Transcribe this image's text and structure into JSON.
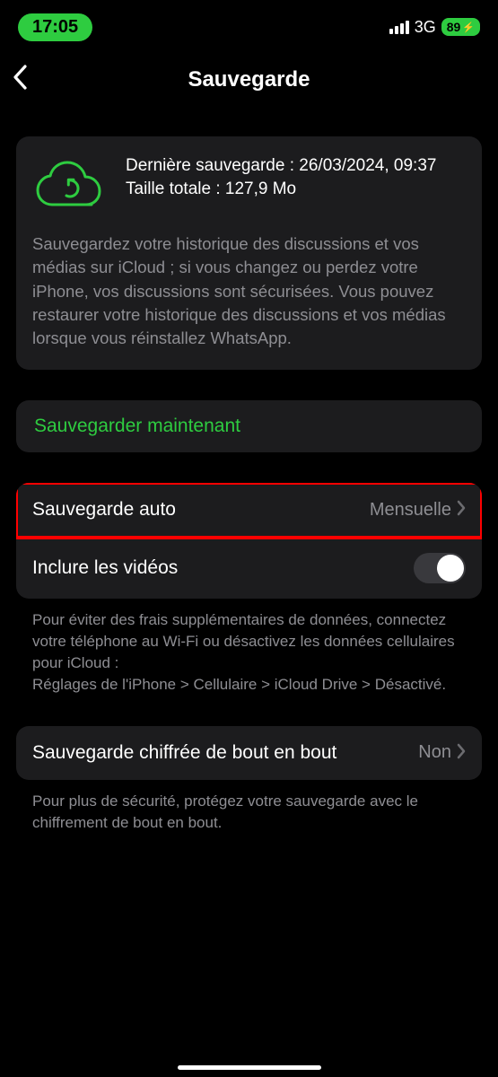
{
  "status_bar": {
    "time": "17:05",
    "network_label": "3G",
    "battery_text": "89"
  },
  "header": {
    "title": "Sauvegarde"
  },
  "info": {
    "last_backup_line": "Dernière sauvegarde : 26/03/2024, 09:37",
    "size_line": "Taille totale : 127,9 Mo",
    "description": "Sauvegardez votre historique des discussions et vos médias sur iCloud ; si vous changez ou perdez votre iPhone, vos discussions sont sécurisées. Vous pouvez restaurer votre historique des discussions et vos médias lorsque vous réinstallez WhatsApp."
  },
  "actions": {
    "backup_now": "Sauvegarder maintenant"
  },
  "settings": {
    "auto_backup": {
      "label": "Sauvegarde auto",
      "value": "Mensuelle"
    },
    "include_videos": {
      "label": "Inclure les vidéos",
      "on": false
    },
    "footer_note": "Pour éviter des frais supplémentaires de données, connectez votre téléphone au Wi-Fi ou désactivez les données cellulaires pour iCloud :\nRéglages de l'iPhone > Cellulaire > iCloud Drive > Désactivé."
  },
  "encryption": {
    "label": "Sauvegarde chiffrée de bout en bout",
    "value": "Non",
    "footer_note": "Pour plus de sécurité, protégez votre sauvegarde avec le chiffrement de bout en bout."
  }
}
